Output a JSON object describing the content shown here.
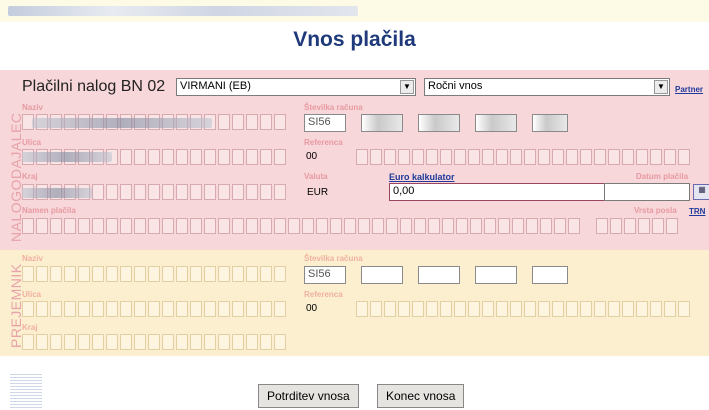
{
  "page_title": "Vnos plačila",
  "header": {
    "label": "Plačilni nalog BN 02",
    "payment_type": "VIRMANI (EB)",
    "entry_mode": "Ročni vnos",
    "partner_link": "Partner"
  },
  "payer": {
    "section_label": "NALOGODAJALEC",
    "naziv_label": "Naziv",
    "ulica_label": "Ulica",
    "kraj_label": "Kraj",
    "namen_label": "Namen plačila",
    "account_label": "Številka računa",
    "account_prefix": "SI56",
    "referenca_label": "Referenca",
    "reference_model": "00",
    "valuta_label": "Valuta",
    "currency": "EUR",
    "euro_calc_link": "Euro kalkulator",
    "amount": "0,00",
    "date_label": "Datum plačila",
    "vrsta_posla_label": "Vrsta posla",
    "trn_link": "TRN"
  },
  "recipient": {
    "section_label": "PREJEMNIK",
    "naziv_label": "Naziv",
    "ulica_label": "Ulica",
    "kraj_label": "Kraj",
    "account_label": "Številka računa",
    "account_prefix": "SI56",
    "referenca_label": "Referenca",
    "reference_model": "00"
  },
  "buttons": {
    "confirm": "Potrditev vnosa",
    "end": "Konec vnosa"
  }
}
